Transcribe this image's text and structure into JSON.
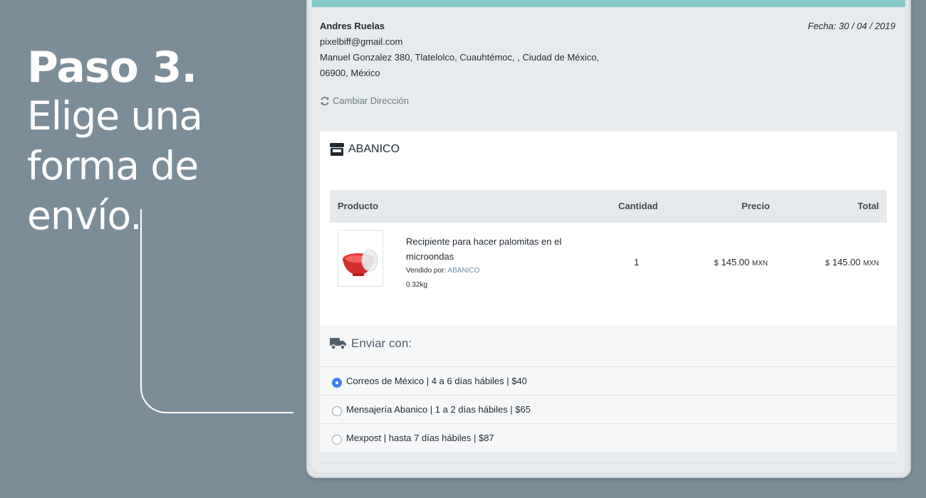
{
  "promo": {
    "step": "Paso 3.",
    "description": "Elige una forma de envío."
  },
  "customer": {
    "name": "Andres Ruelas",
    "email": "pixelbiff@gmail.com",
    "address_line1": "Manuel Gonzalez 380, Tlatelolco, Cuauhtémoc, , Ciudad de México,",
    "address_line2": "06900, México"
  },
  "date": "Fecha: 30 / 04 / 2019",
  "change_address_label": "Cambiar Dirección",
  "store": {
    "name": "ABANICO",
    "icon": "store-icon"
  },
  "table": {
    "headers": {
      "product": "Producto",
      "quantity": "Cantidad",
      "price": "Precio",
      "total": "Total"
    },
    "rows": [
      {
        "name": "Recipiente para hacer palomitas en el microondas",
        "sold_by_label": "Vendido por:",
        "seller": "ABANICO",
        "weight": "0.32kg",
        "quantity": "1",
        "price_symbol": "$",
        "price": "145.00",
        "price_currency": "MXN",
        "total_symbol": "$",
        "total": "145.00",
        "total_currency": "MXN"
      }
    ]
  },
  "shipping": {
    "title": "Enviar con:",
    "icon": "truck-icon",
    "options": [
      {
        "label": "Correos de México | 4 a 6 días hábiles | $40",
        "selected": true
      },
      {
        "label": "Mensajería Abanico | 1 a 2 días hábiles | $65",
        "selected": false
      },
      {
        "label": "Mexpost | hasta 7 días hábiles | $87",
        "selected": false
      }
    ]
  },
  "colors": {
    "background": "#7b8d98",
    "accent_bar": "#86cacb",
    "radio_selected": "#3b82f6"
  }
}
